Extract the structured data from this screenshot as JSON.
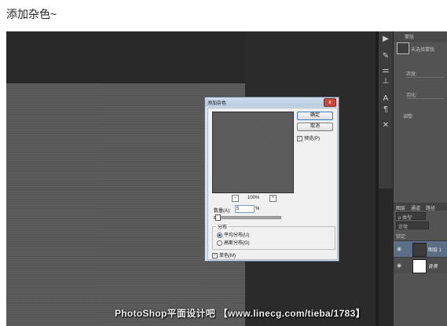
{
  "caption": "添加杂色~",
  "tools": [
    "play-icon",
    "brush-icon",
    "paragraph-icon",
    "character-icon",
    "text-icon",
    "pilcrow-icon",
    "tools-icon"
  ],
  "tool_glyphs": [
    "▶",
    "✎",
    "⚌",
    "⊥",
    "A",
    "¶",
    "✕"
  ],
  "right_panel": {
    "top_label": "蒙版",
    "mask_label": "未选择蒙版",
    "density_label": "浓度:",
    "feather_label": "羽化:",
    "adjust_label": "调整:"
  },
  "layers_panel": {
    "tabs": [
      "图层",
      "通道",
      "路径"
    ],
    "kind_label": "ρ 类型",
    "blend_mode": "正常",
    "lock_label": "锁定:",
    "layers": [
      {
        "name": "图层 1",
        "selected": true
      },
      {
        "name": "背景",
        "selected": false
      }
    ]
  },
  "dialog": {
    "title": "添加杂色",
    "close_label": "x",
    "ok_label": "确定",
    "cancel_label": "取消",
    "preview_label": "预览(P)",
    "preview_checked": true,
    "zoom_minus": "−",
    "zoom_plus": "+",
    "zoom_level": "100%",
    "amount_label": "数量(A):",
    "amount_value": "5",
    "amount_unit": "%",
    "amount_slider_fraction": 0.05,
    "distribution_label": "分布",
    "uniform_label": "平均分布(U)",
    "gaussian_label": "高斯分布(G)",
    "selected_distribution": "uniform",
    "monochrome_label": "单色(M)",
    "monochrome_checked": true,
    "check_mark": "✓"
  },
  "watermark": "PhotoShop平面设计吧 【www.linecg.com/tieba/1783】",
  "colors": {
    "canvas": "#5a5a5a",
    "workspace": "#282828",
    "dialog_frame": "#d9e4f1",
    "close_button": "#c9483c",
    "selected_layer": "#5c6e86"
  }
}
